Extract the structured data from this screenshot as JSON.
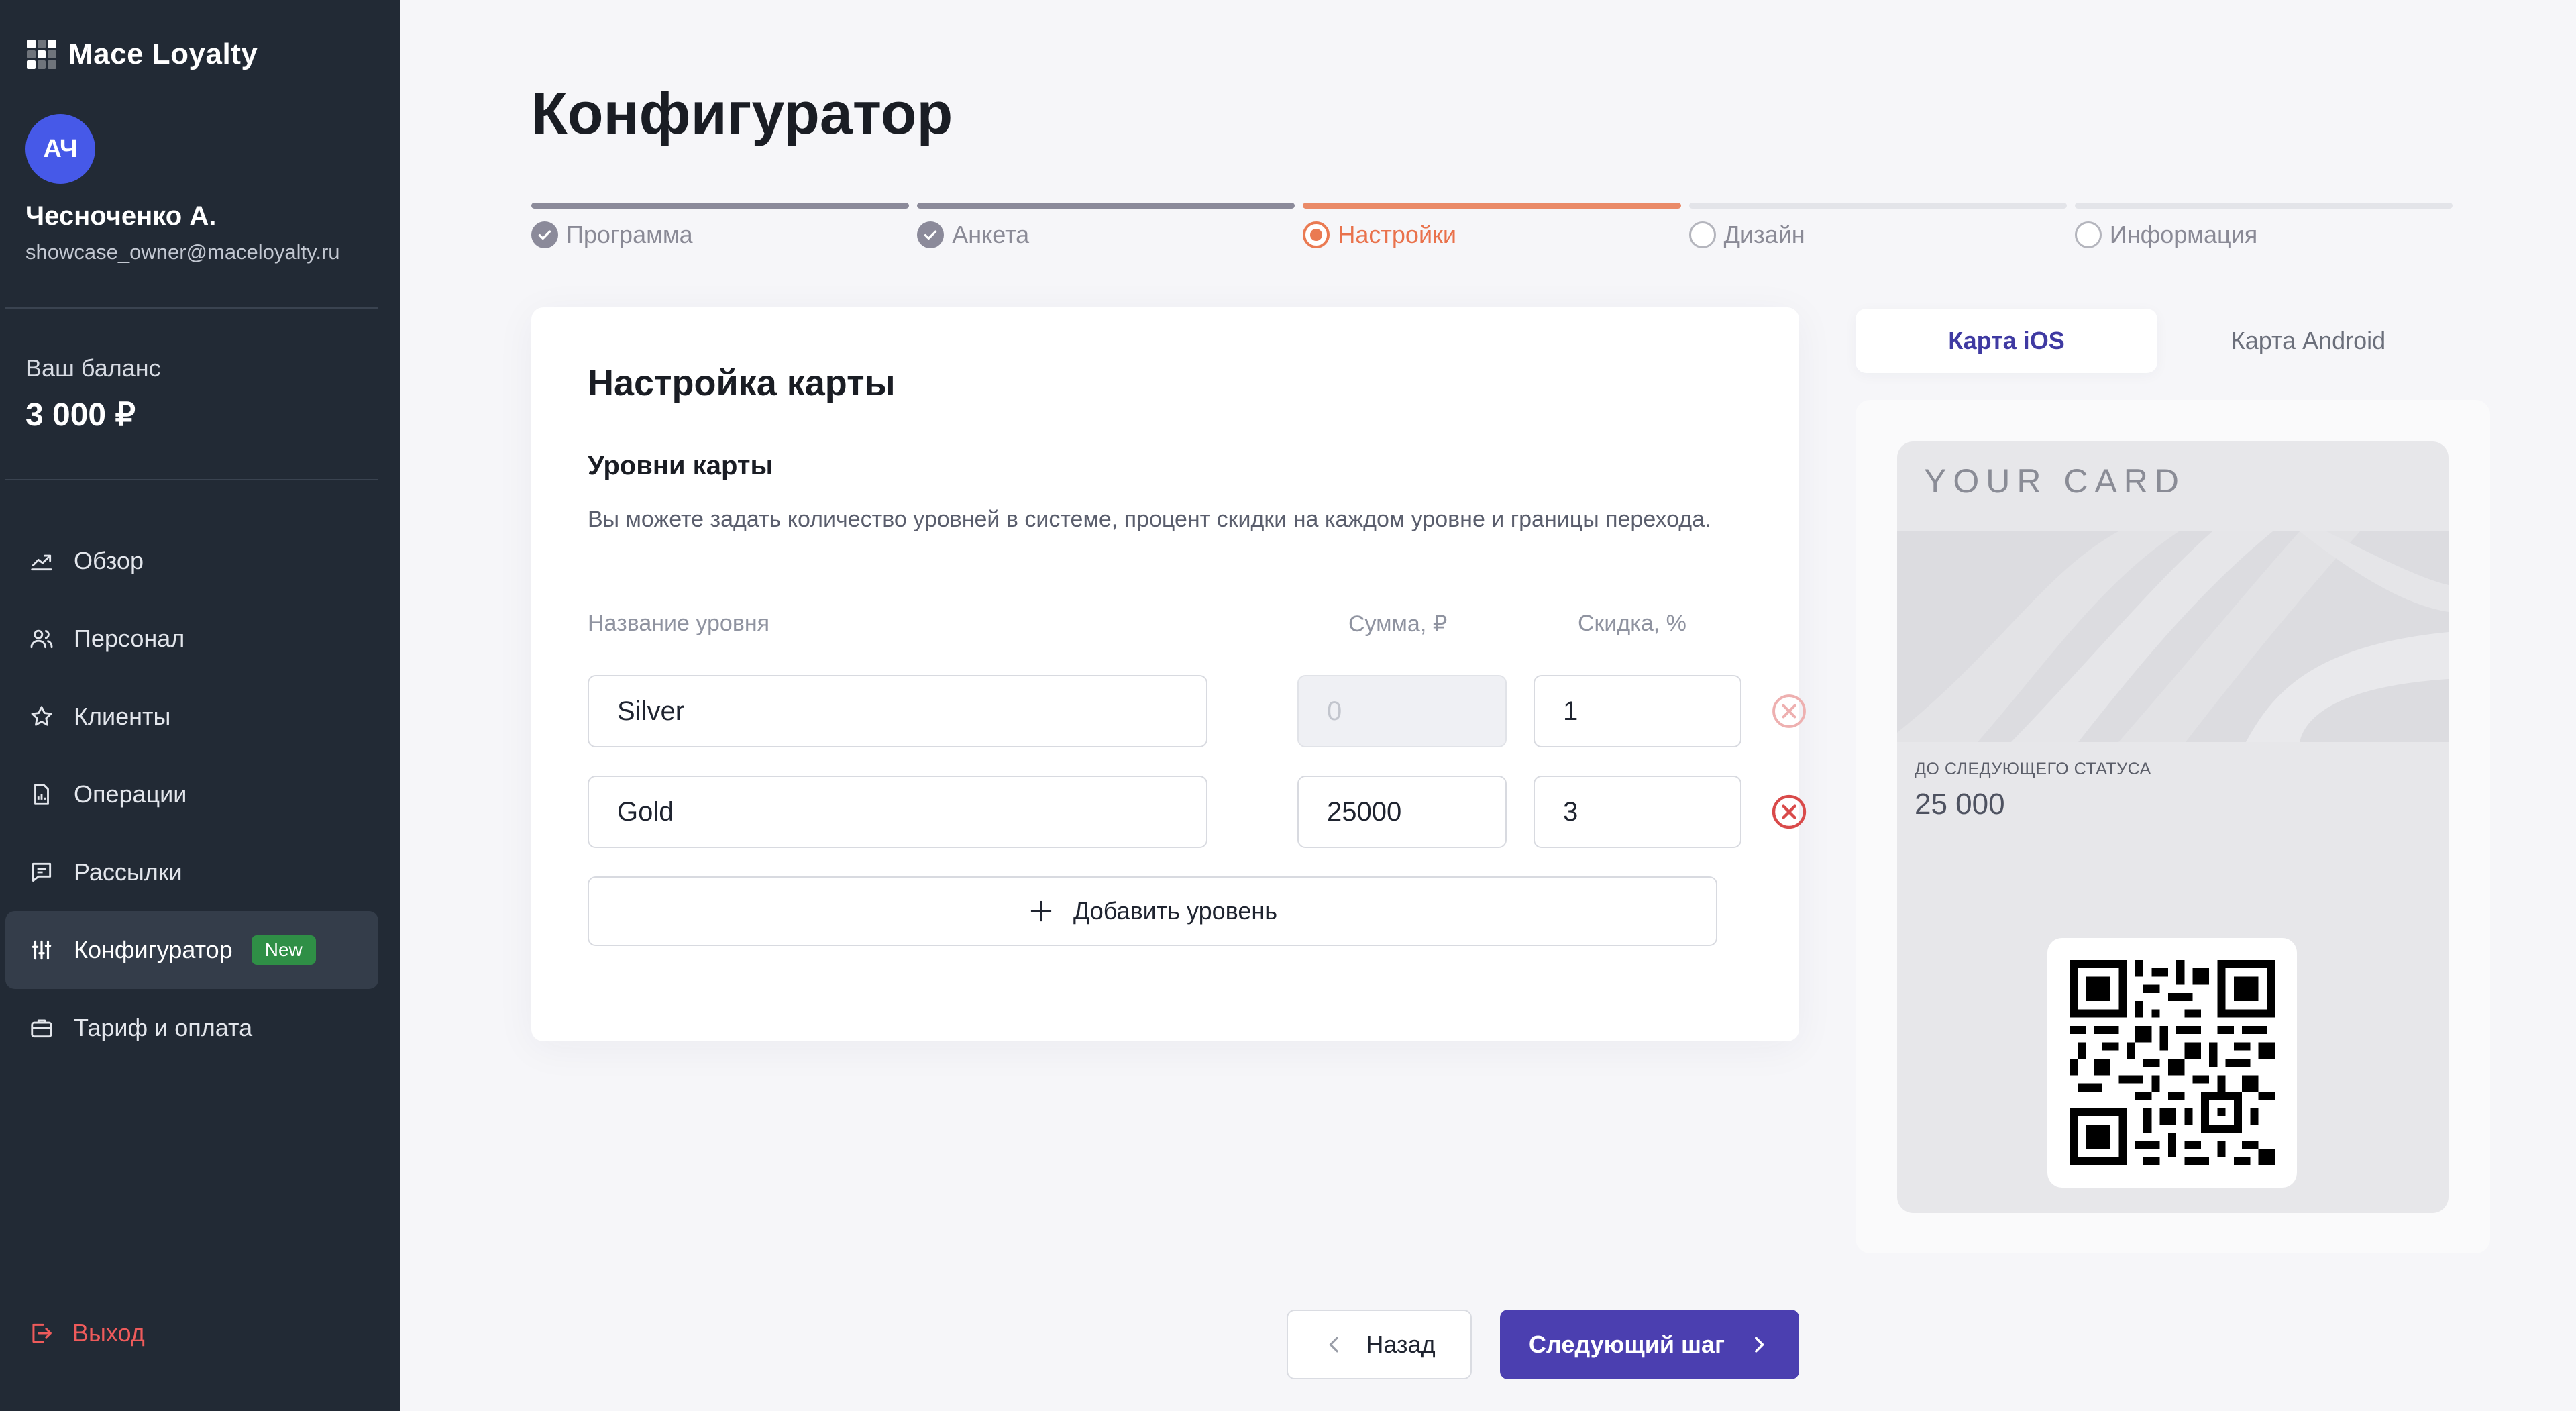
{
  "brand": {
    "name": "Mace Loyalty"
  },
  "user": {
    "initials": "АЧ",
    "name": "Чесноченко А.",
    "email": "showcase_owner@maceloyalty.ru"
  },
  "balance": {
    "label": "Ваш баланс",
    "value": "3 000 ₽"
  },
  "nav": {
    "items": [
      {
        "label": "Обзор",
        "icon": "chart-icon"
      },
      {
        "label": "Персонал",
        "icon": "users-icon"
      },
      {
        "label": "Клиенты",
        "icon": "star-icon"
      },
      {
        "label": "Операции",
        "icon": "document-icon"
      },
      {
        "label": "Рассылки",
        "icon": "message-icon"
      },
      {
        "label": "Конфигуратор",
        "icon": "sliders-icon",
        "active": true,
        "badge": "New"
      },
      {
        "label": "Тариф и оплата",
        "icon": "briefcase-icon"
      }
    ],
    "logout": "Выход"
  },
  "page": {
    "title": "Конфигуратор"
  },
  "stepper": {
    "steps": [
      {
        "label": "Программа",
        "state": "done"
      },
      {
        "label": "Анкета",
        "state": "done"
      },
      {
        "label": "Настройки",
        "state": "current"
      },
      {
        "label": "Дизайн",
        "state": "todo"
      },
      {
        "label": "Информация",
        "state": "todo"
      }
    ]
  },
  "settings": {
    "title": "Настройка карты",
    "section_title": "Уровни карты",
    "description": "Вы можете задать количество уровней в системе, процент скидки на каждом уровне и границы перехода.",
    "columns": {
      "name": "Название уровня",
      "sum": "Сумма, ₽",
      "discount": "Скидка, %"
    },
    "levels": [
      {
        "name": "Silver",
        "sum": "",
        "sum_placeholder": "0",
        "sum_disabled": true,
        "discount": "1",
        "removable": false
      },
      {
        "name": "Gold",
        "sum": "25000",
        "sum_placeholder": "",
        "sum_disabled": false,
        "discount": "3",
        "removable": true
      }
    ],
    "add_level": "Добавить уровень"
  },
  "preview": {
    "tabs": [
      {
        "label": "Карта iOS",
        "active": true
      },
      {
        "label": "Карта Android",
        "active": false
      }
    ],
    "card": {
      "title": "YOUR CARD",
      "next_status_label": "ДО СЛЕДУЮЩЕГО СТАТУСА",
      "next_status_value": "25 000"
    }
  },
  "footer": {
    "back": "Назад",
    "next": "Следующий шаг"
  },
  "colors": {
    "sidebar_bg": "#222a35",
    "accent": "#4b3fb0",
    "step_current": "#ea7a52",
    "step_done": "#8b8a9a",
    "badge_green": "#2f8f46",
    "logout_red": "#ef5b5b",
    "remove_red": "#d94a4a"
  }
}
